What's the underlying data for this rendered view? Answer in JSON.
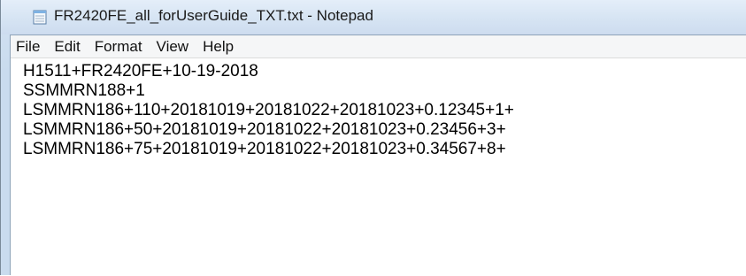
{
  "window": {
    "title": "FR2420FE_all_forUserGuide_TXT.txt - Notepad",
    "icon": "notepad-icon"
  },
  "menu": {
    "items": [
      "File",
      "Edit",
      "Format",
      "View",
      "Help"
    ]
  },
  "document": {
    "lines": [
      "H1511+FR2420FE+10-19-2018",
      "SSMMRN188+1",
      "LSMMRN186+110+20181019+20181022+20181023+0.12345+1+",
      "LSMMRN186+50+20181019+20181022+20181023+0.23456+3+",
      "LSMMRN186+75+20181019+20181022+20181023+0.34567+8+"
    ]
  },
  "colors": {
    "titlebar": "#d6e4f3",
    "menubar": "#f5f6f7",
    "editor_background": "#ffffff",
    "text": "#000000"
  }
}
